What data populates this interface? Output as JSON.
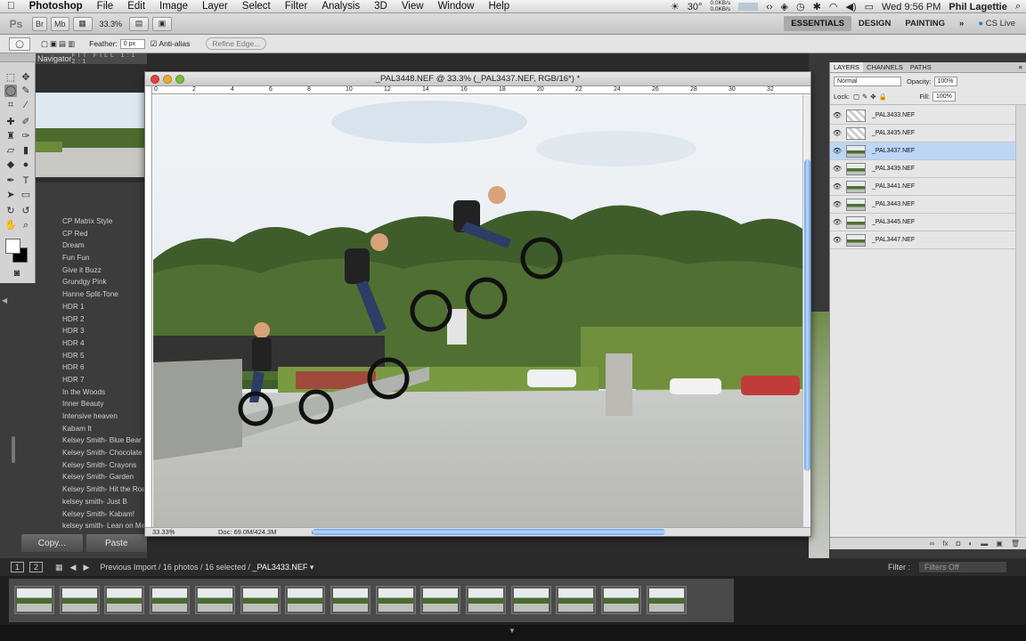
{
  "menubar": {
    "apple": "",
    "app_name": "Photoshop",
    "items": [
      "File",
      "Edit",
      "Image",
      "Layer",
      "Select",
      "Filter",
      "Analysis",
      "3D",
      "View",
      "Window",
      "Help"
    ],
    "temperature": "30°",
    "net_up": "0.0KB/s",
    "net_down": "0.0KB/s",
    "clock": "Wed 9:56 PM",
    "user": "Phil Lagettie"
  },
  "appbar": {
    "logo": "Ps",
    "br": "Br",
    "mb": "Mb",
    "zoom": "33.3%",
    "workspaces": [
      "ESSENTIALS",
      "DESIGN",
      "PAINTING"
    ],
    "active_workspace": "ESSENTIALS",
    "more": "»",
    "cs_live": "CS Live"
  },
  "options": {
    "feather_label": "Feather:",
    "feather_value": "0 px",
    "antialias_label": "Anti-alias",
    "refine_edge": "Refine Edge..."
  },
  "navigator": {
    "title": "Navigator",
    "options": "FIT  FILL  1:1  2:1"
  },
  "presets": [
    "CP Matrix Style",
    "CP Red",
    "Dream",
    "Fun Fun",
    "Give it Buzz",
    "Grundgy Pink",
    "Hanne Split-Tone",
    "HDR 1",
    "HDR 2",
    "HDR 3",
    "HDR 4",
    "HDR 5",
    "HDR 6",
    "HDR 7",
    "In the Woods",
    "Inner Beauty",
    "Intensive heaven",
    "Kabam It",
    "Kelsey Smith- Blue Bear",
    "Kelsey Smith- Chocolate",
    "Kelsey Smith- Crayons",
    "Kelsey Smith- Garden",
    "Kelsey Smith- Hit the Road",
    "kelsey smith- Just B",
    "Kelsey Smith- Kabam!",
    "kelsey smith- Lean on Me"
  ],
  "lr_buttons": {
    "copy": "Copy...",
    "paste": "Paste"
  },
  "document": {
    "title": "_PAL3448.NEF @ 33.3% (_PAL3437.NEF, RGB/16*) *",
    "zoom": "33.33%",
    "doc_info": "Doc: 69.0M/424.3M",
    "ruler_ticks": [
      "0",
      "2",
      "4",
      "6",
      "8",
      "10",
      "12",
      "14",
      "16",
      "18",
      "20",
      "22",
      "24",
      "26",
      "28",
      "30",
      "32"
    ]
  },
  "layers_panel": {
    "tabs": [
      "LAYERS",
      "CHANNELS",
      "PATHS"
    ],
    "blend_mode": "Normal",
    "opacity_label": "Opacity:",
    "opacity": "100%",
    "lock_label": "Lock:",
    "fill_label": "Fill:",
    "fill": "100%",
    "layers": [
      {
        "name": "_PAL3433.NEF",
        "selected": false
      },
      {
        "name": "_PAL3435.NEF",
        "selected": false
      },
      {
        "name": "_PAL3437.NEF",
        "selected": true
      },
      {
        "name": "_PAL3439.NEF",
        "selected": false
      },
      {
        "name": "_PAL3441.NEF",
        "selected": false
      },
      {
        "name": "_PAL3443.NEF",
        "selected": false
      },
      {
        "name": "_PAL3445.NEF",
        "selected": false
      },
      {
        "name": "_PAL3447.NEF",
        "selected": false
      }
    ]
  },
  "filmstrip": {
    "page1": "1",
    "page2": "2",
    "source": "Previous Import / 16 photos / 16 selected / ",
    "current_file": "_PAL3433.NEF",
    "filter_label": "Filter :",
    "filter_value": "Filters Off",
    "thumb_count": 15
  },
  "colors": {
    "selection": "#bcd6f6",
    "accent_blue": "#6aa4e8",
    "lr_dark": "#3c3c3c"
  }
}
